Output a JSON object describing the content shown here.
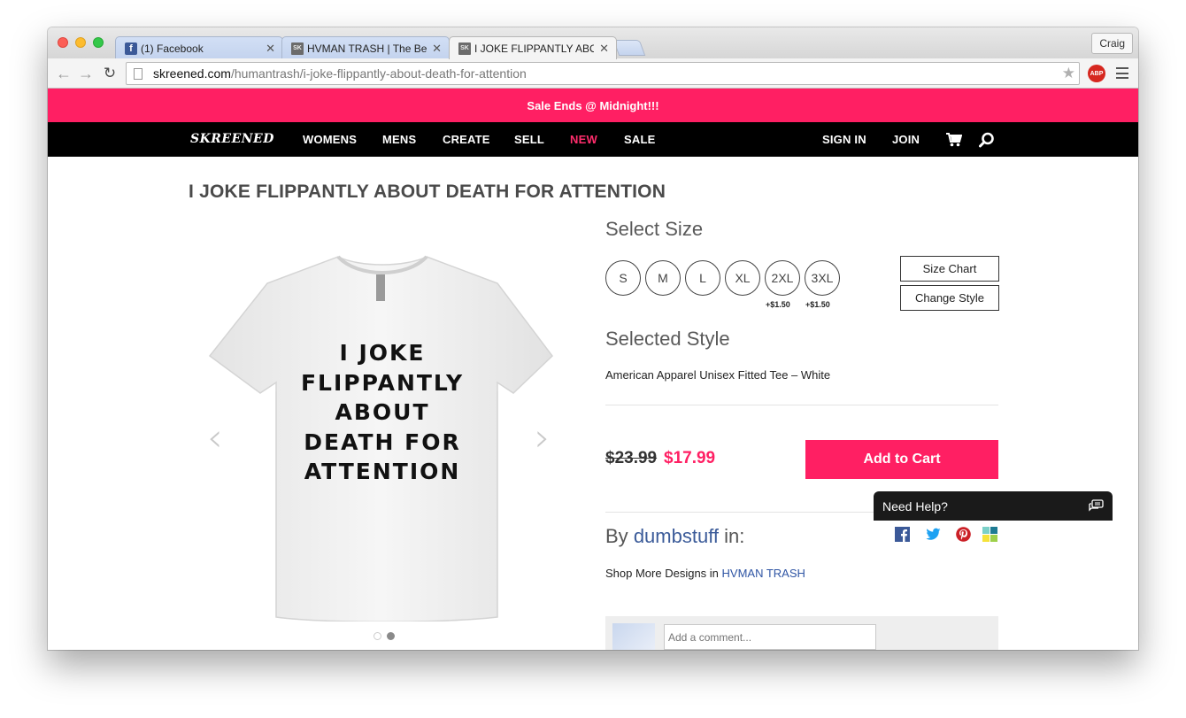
{
  "browser": {
    "tabs": [
      {
        "title": "(1) Facebook",
        "favicon": "facebook-f"
      },
      {
        "title": "HVMAN TRASH | The Best",
        "favicon": "SK"
      },
      {
        "title": "I JOKE FLIPPANTLY ABOU",
        "favicon": "SK"
      }
    ],
    "profile_name": "Craig",
    "url_host": "skreened.com",
    "url_path": "/humantrash/i-joke-flippantly-about-death-for-attention",
    "extension_label": "ABP"
  },
  "site": {
    "promo": "Sale Ends @ Midnight!!!",
    "logo": "SKREENED",
    "nav": {
      "womens": "WOMENS",
      "mens": "MENS",
      "create": "CREATE",
      "sell": "SELL",
      "new": "NEW",
      "sale": "SALE",
      "signin": "SIGN IN",
      "join": "JOIN"
    },
    "colors": {
      "accent": "#ff1f63",
      "nav_bg": "#000000",
      "link": "#2f55a4"
    }
  },
  "product": {
    "title": "I JOKE FLIPPANTLY ABOUT DEATH FOR ATTENTION",
    "shirt_print": [
      "I JOKE",
      "FLIPPANTLY",
      "ABOUT",
      "DEATH FOR",
      "ATTENTION"
    ],
    "gallery_pages": 2,
    "gallery_current": 2,
    "select_size_heading": "Select Size",
    "sizes": [
      "S",
      "M",
      "L",
      "XL",
      "2XL",
      "3XL"
    ],
    "size_surcharges": {
      "2XL": "+$1.50",
      "3XL": "+$1.50"
    },
    "size_chart_label": "Size Chart",
    "change_style_label": "Change Style",
    "selected_style_heading": "Selected Style",
    "style_name": "American Apparel Unisex Fitted Tee – White",
    "old_price": "$23.99",
    "new_price": "$17.99",
    "add_to_cart_label": "Add to Cart",
    "by_prefix": "By",
    "author": "dumbstuff",
    "by_suffix": "in:",
    "shop_more_prefix": "Shop More Designs in",
    "shop_name": "HVMAN TRASH",
    "comment_placeholder": "Add a comment..."
  },
  "help_widget": {
    "label": "Need Help?"
  }
}
